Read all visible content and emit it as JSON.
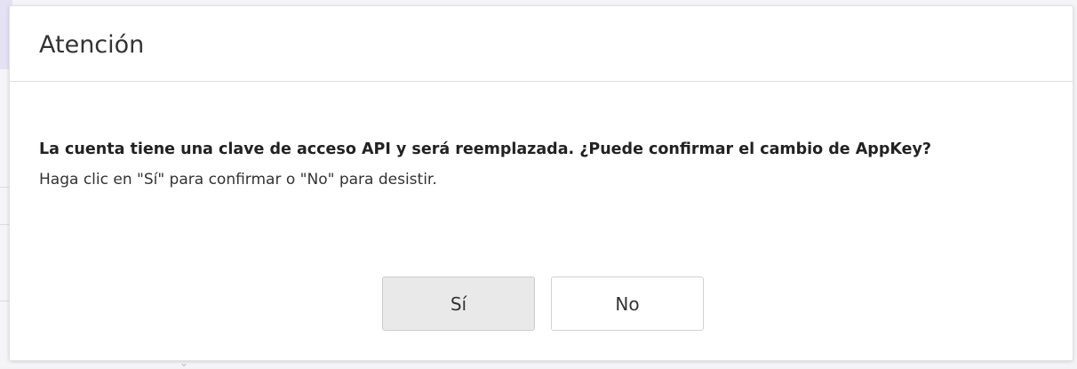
{
  "dialog": {
    "title": "Atención",
    "message_bold": "La cuenta tiene una clave de acceso API y será reemplazada. ¿Puede confirmar el cambio de AppKey?",
    "message_hint": "Haga clic en \"Sí\" para confirmar o \"No\" para desistir.",
    "buttons": {
      "yes_label": "Sí",
      "no_label": "No"
    }
  },
  "colors": {
    "dialog_background": "#ffffff",
    "text_primary": "#333333",
    "yes_button_background": "#e9e9e9",
    "border": "#d2d2d2"
  }
}
